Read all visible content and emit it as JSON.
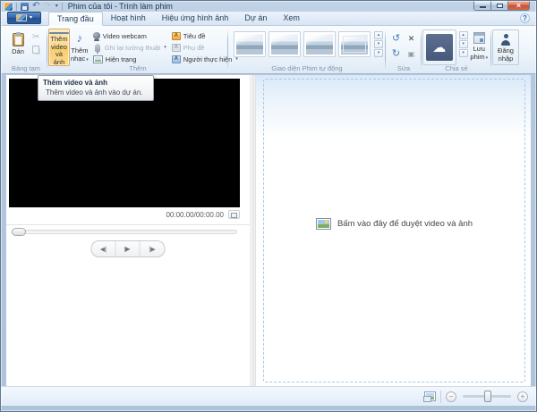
{
  "titlebar": {
    "title": "Phim của tôi - Trình làm phim",
    "undo_glyph": "↶",
    "redo_glyph": "↷",
    "dropdown_glyph": "▾",
    "close_glyph": "×"
  },
  "tabs": {
    "menu_dropdown_glyph": "▾",
    "help_glyph": "?",
    "items": [
      {
        "label": "Trang đầu",
        "active": true
      },
      {
        "label": "Hoạt hình",
        "active": false
      },
      {
        "label": "Hiệu ứng hình ảnh",
        "active": false
      },
      {
        "label": "Dự án",
        "active": false
      },
      {
        "label": "Xem",
        "active": false
      }
    ]
  },
  "ribbon": {
    "clipboard": {
      "label": "Bảng tạm",
      "paste": "Dán",
      "cut_glyph": "✂"
    },
    "add": {
      "label": "Thêm",
      "add_videos_photos": "Thêm video và ảnh",
      "add_music": "Thêm nhạc",
      "music_note_glyph": "♪",
      "music_dropdown_glyph": "▾",
      "webcam_video": "Video webcam",
      "record_narration": "Ghi lại tường thuật",
      "narration_dropdown_glyph": "▾",
      "snapshot": "Hiện trạng",
      "title": "Tiêu đề",
      "caption": "Phụ đề",
      "credits": "Người thực hiện",
      "credits_dropdown_glyph": "▾",
      "title_icon_glyph": "A",
      "caption_icon_glyph": "A",
      "credits_icon_glyph": "A"
    },
    "automovie": {
      "label": "Giao diện Phim tự động",
      "up_glyph": "▴",
      "down_glyph": "▾",
      "more_glyph": "▾"
    },
    "edit": {
      "label": "Sửa",
      "rotate_left_glyph": "↺",
      "remove_glyph": "✕",
      "rotate_right_glyph": "↻",
      "select_glyph": "▣"
    },
    "share": {
      "label": "Chia sẻ",
      "cloud_glyph": "☁",
      "save_movie": "Lưu phim",
      "save_dropdown_glyph": "▾",
      "up_glyph": "▴",
      "down_glyph": "▾",
      "more_glyph": "▾"
    },
    "sign_in": "Đăng nhập"
  },
  "tooltip": {
    "title": "Thêm video và ảnh",
    "description": "Thêm video và ảnh vào dự án."
  },
  "preview": {
    "time": "00:00.00/00:00.00",
    "prev_frame_glyph": "◀|",
    "play_glyph": "▶",
    "next_frame_glyph": "|▶"
  },
  "storyboard": {
    "empty_text": "Bấm vào đây để duyệt video và ảnh"
  },
  "statusbar": {
    "zoom_out_glyph": "−",
    "zoom_in_glyph": "+"
  },
  "colors": {
    "selected_button_bg": "#fbd88c",
    "selected_button_border": "#d9a558",
    "onedrive_button_bg": "#4c5e7a",
    "close_button_red": "#c84f35",
    "window_frame": "#b4c8de",
    "dropzone_dashed_border": "#a9c7e5"
  }
}
